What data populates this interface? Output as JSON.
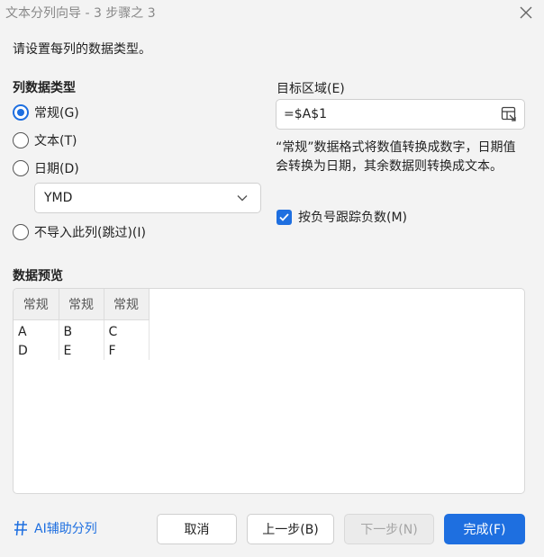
{
  "window": {
    "title": "文本分列向导 - 3 步骤之 3"
  },
  "instruction": "请设置每列的数据类型。",
  "column_type": {
    "heading": "列数据类型",
    "options": [
      {
        "label": "常规(G)",
        "checked": true
      },
      {
        "label": "文本(T)",
        "checked": false
      },
      {
        "label": "日期(D)",
        "checked": false
      },
      {
        "label": "不导入此列(跳过)(I)",
        "checked": false
      }
    ],
    "date_format": "YMD"
  },
  "target": {
    "label": "目标区域(E)",
    "value": "=$A$1"
  },
  "description": "“常规”数据格式将数值转换成数字，日期值会转换为日期，其余数据则转换成文本。",
  "negative_checkbox": {
    "label": "按负号跟踪负数(M)",
    "checked": true
  },
  "preview": {
    "heading": "数据预览",
    "headers": [
      "常规",
      "常规",
      "常规"
    ],
    "rows": [
      [
        "A",
        "B",
        "C"
      ],
      [
        "D",
        "E",
        "F"
      ]
    ]
  },
  "footer": {
    "ai_link": "AI辅助分列",
    "cancel": "取消",
    "back": "上一步(B)",
    "next": "下一步(N)",
    "finish": "完成(F)"
  },
  "colors": {
    "accent": "#1e6fe0"
  }
}
